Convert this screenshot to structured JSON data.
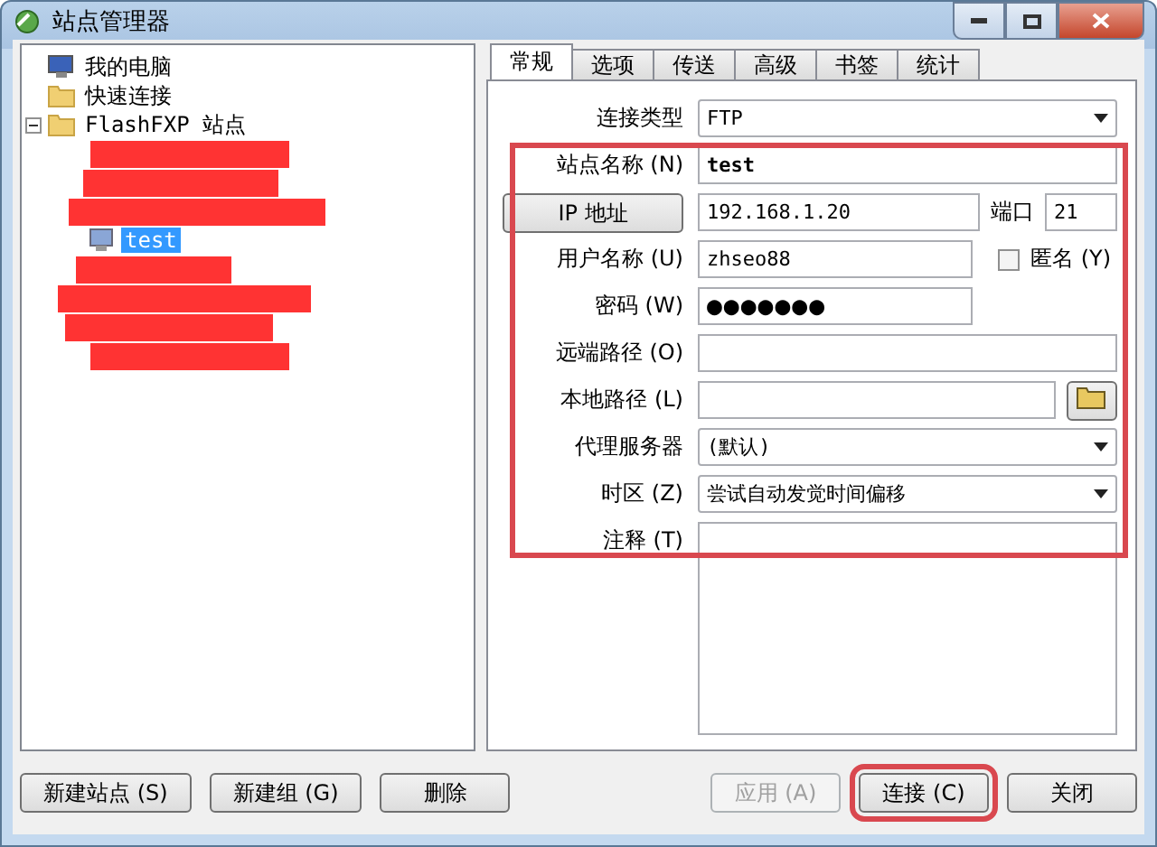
{
  "window": {
    "title": "站点管理器"
  },
  "tree": [
    {
      "label": "我的电脑",
      "kind": "computer",
      "selected": false
    },
    {
      "label": "快速连接",
      "kind": "folder",
      "selected": false
    },
    {
      "label": "FlashFXP 站点",
      "kind": "folder",
      "selected": false,
      "expanded": true,
      "children": [
        {
          "kind": "redacted"
        },
        {
          "kind": "redacted"
        },
        {
          "kind": "redacted"
        },
        {
          "label": "test",
          "kind": "site",
          "selected": true
        },
        {
          "kind": "redacted"
        },
        {
          "kind": "redacted"
        },
        {
          "kind": "redacted"
        },
        {
          "kind": "redacted"
        }
      ]
    }
  ],
  "tabs": [
    {
      "label": "常规",
      "selected": true
    },
    {
      "label": "选项",
      "selected": false
    },
    {
      "label": "传送",
      "selected": false
    },
    {
      "label": "高级",
      "selected": false
    },
    {
      "label": "书签",
      "selected": false
    },
    {
      "label": "统计",
      "selected": false
    }
  ],
  "form": [
    {
      "label": "连接类型",
      "kind": "dropdown",
      "value": "FTP"
    },
    {
      "label": "站点名称 (N)",
      "kind": "text",
      "value": "test",
      "bold": true
    },
    {
      "label": "IP 地址",
      "kind": "ip",
      "value": "192.168.1.20",
      "port_label": "端口",
      "port": "21"
    },
    {
      "label": "用户名称 (U)",
      "kind": "user",
      "value": "zhseo88",
      "check_label": "匿名 (Y)",
      "checked": false
    },
    {
      "label": "密码 (W)",
      "kind": "password",
      "value": "●●●●●●●"
    },
    {
      "label": "远端路径 (O)",
      "kind": "text"
    },
    {
      "label": "本地路径 (L)",
      "kind": "browse"
    },
    {
      "label": "代理服务器",
      "kind": "dropdown",
      "value": "(默认)"
    },
    {
      "label": "时区 (Z)",
      "kind": "dropdown",
      "value": "尝试自动发觉时间偏移"
    },
    {
      "label": "注释 (T)",
      "kind": "notes"
    }
  ],
  "left_buttons": [
    {
      "label": "新建站点 (S)",
      "disabled": false
    },
    {
      "label": "新建组 (G)",
      "disabled": false
    },
    {
      "label": "删除",
      "disabled": false
    }
  ],
  "right_buttons": [
    {
      "label": "应用 (A)",
      "disabled": true
    },
    {
      "label": "连接 (C)",
      "disabled": false
    },
    {
      "label": "关闭",
      "disabled": false
    }
  ]
}
